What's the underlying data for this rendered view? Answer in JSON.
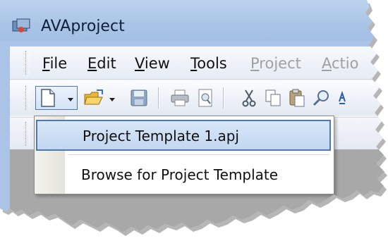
{
  "window": {
    "title": "AVAproject"
  },
  "menubar": {
    "items": [
      {
        "label": "File",
        "mnemonic": "F",
        "rest": "ile",
        "enabled": true
      },
      {
        "label": "Edit",
        "mnemonic": "E",
        "rest": "dit",
        "enabled": true
      },
      {
        "label": "View",
        "mnemonic": "V",
        "rest": "iew",
        "enabled": true
      },
      {
        "label": "Tools",
        "mnemonic": "T",
        "rest": "ools",
        "enabled": true
      },
      {
        "label": "Project",
        "mnemonic": "P",
        "rest": "roject",
        "enabled": false
      },
      {
        "label": "Actio",
        "mnemonic": "A",
        "rest": "ctio",
        "enabled": false
      }
    ]
  },
  "toolbar": {
    "buttons": [
      "new-file-icon",
      "open-folder-icon",
      "save-icon",
      "print-icon",
      "print-preview-icon",
      "cut-icon",
      "copy-icon",
      "paste-icon",
      "find-icon",
      "sort-icon"
    ]
  },
  "dropdown": {
    "items": [
      {
        "label": "Project Template 1.apj",
        "highlighted": true
      },
      {
        "label": "Browse for Project Template",
        "highlighted": false
      }
    ]
  },
  "colors": {
    "titlebar": "#a9c4e6",
    "highlight_border": "#4d78b6",
    "highlight_fill": "#c3d7f1",
    "workspace": "#a8a8a8"
  }
}
